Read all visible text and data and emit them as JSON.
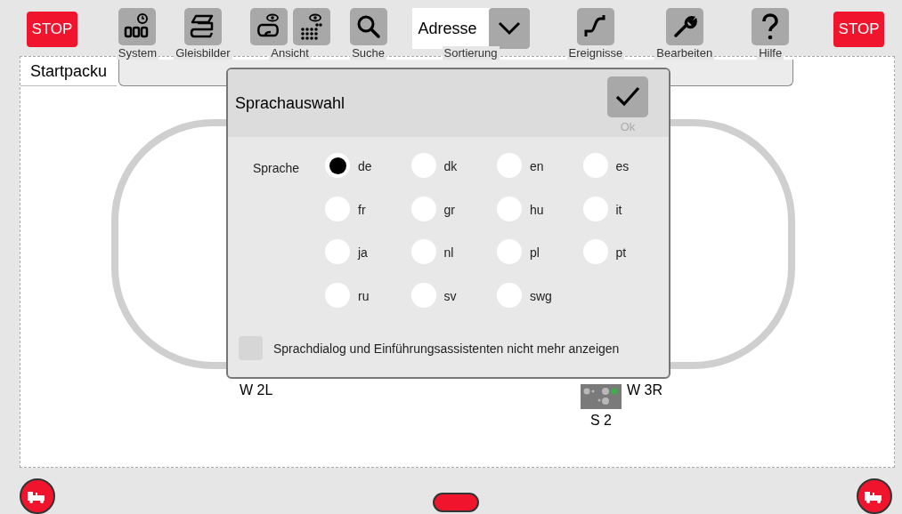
{
  "toolbar": {
    "stop_left": "STOP",
    "stop_right": "STOP",
    "tools": [
      {
        "kind": "single",
        "label": "System"
      },
      {
        "kind": "single",
        "label": "Gleisbilder"
      },
      {
        "kind": "double",
        "label": "Ansicht"
      },
      {
        "kind": "single",
        "label": "Suche"
      },
      {
        "kind": "dropdown",
        "label": "Sortierung",
        "value": "Adresse"
      },
      {
        "kind": "single",
        "label": "Ereignisse"
      },
      {
        "kind": "single",
        "label": "Bearbeiten"
      },
      {
        "kind": "single",
        "label": "Hilfe"
      }
    ]
  },
  "layout": {
    "title": "Startpacku",
    "labels": [
      {
        "text": "W 2L"
      },
      {
        "text": "W 3R"
      },
      {
        "text": "S 2"
      }
    ]
  },
  "dialog": {
    "title": "Sprachauswahl",
    "ok_label": "Ok",
    "field_label": "Sprache",
    "languages": [
      {
        "label": "de",
        "selected": true
      },
      {
        "label": "dk",
        "selected": false
      },
      {
        "label": "en",
        "selected": false
      },
      {
        "label": "es",
        "selected": false
      },
      {
        "label": "fr",
        "selected": false
      },
      {
        "label": "gr",
        "selected": false
      },
      {
        "label": "hu",
        "selected": false
      },
      {
        "label": "it",
        "selected": false
      },
      {
        "label": "ja",
        "selected": false
      },
      {
        "label": "nl",
        "selected": false
      },
      {
        "label": "pl",
        "selected": false
      },
      {
        "label": "pt",
        "selected": false
      },
      {
        "label": "ru",
        "selected": false
      },
      {
        "label": "sv",
        "selected": false
      },
      {
        "label": "swg",
        "selected": false
      }
    ],
    "dont_show_again": {
      "label": "Sprachdialog und Einführungsassistenten nicht mehr anzeigen",
      "checked": false
    }
  }
}
